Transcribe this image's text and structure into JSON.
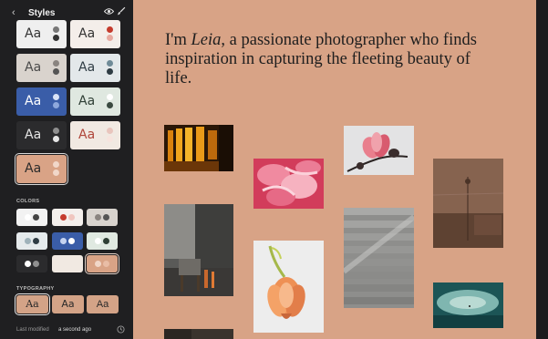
{
  "sidebar": {
    "back_glyph": "‹",
    "title": "Styles",
    "icons": [
      "eye-icon",
      "brush-icon"
    ],
    "theme_tiles": [
      {
        "label": "Aa",
        "bg": "#efefef",
        "fg": "#333333",
        "dot1": "#777777",
        "dot2": "#333333"
      },
      {
        "label": "Aa",
        "bg": "#f4eeea",
        "fg": "#333333",
        "dot1": "#c53b2d",
        "dot2": "#e8a9a0"
      },
      {
        "label": "Aa",
        "bg": "#d9d3cd",
        "fg": "#4a4a4a",
        "dot1": "#8a8480",
        "dot2": "#555555"
      },
      {
        "label": "Aa",
        "bg": "#e3e8ea",
        "fg": "#2f3c44",
        "dot1": "#6f8b98",
        "dot2": "#2f3c44"
      },
      {
        "label": "Aa",
        "bg": "#3a5da8",
        "fg": "#ffffff",
        "dot1": "#dbe4f7",
        "dot2": "#8ea8dc"
      },
      {
        "label": "Aa",
        "bg": "#dfe8e0",
        "fg": "#2f3f35",
        "dot1": "#ffffff",
        "dot2": "#3a4a40"
      },
      {
        "label": "Aa",
        "bg": "#2b2b2d",
        "fg": "#e6e6e6",
        "dot1": "#8f8f8f",
        "dot2": "#e6e6e6"
      },
      {
        "label": "Aa",
        "bg": "#f1e9e2",
        "fg": "#b0463a",
        "dot1": "#e9c5bd",
        "dot2": "#f7e4de"
      },
      {
        "label": "Aa",
        "bg": "#d9a386",
        "fg": "#2a2a2a",
        "dot1": "#f1d7c9",
        "dot2": "#f1d7c9"
      }
    ],
    "colors_heading": "COLORS",
    "color_swatches": [
      {
        "bg": "#f2f2f2",
        "c1": "#ffffff",
        "c2": "#444444"
      },
      {
        "bg": "#f4efec",
        "c1": "#c53b2d",
        "c2": "#f0c6bf"
      },
      {
        "bg": "#d8d3ce",
        "c1": "#8a8480",
        "c2": "#555555"
      },
      {
        "bg": "#e5eaec",
        "c1": "#9fb2ba",
        "c2": "#2f3c44"
      },
      {
        "bg": "#3a5da8",
        "c1": "#c5d3f0",
        "c2": "#ffffff"
      },
      {
        "bg": "#e0e9e1",
        "c1": "#ffffff",
        "c2": "#2f3f35"
      },
      {
        "bg": "#2b2b2d",
        "c1": "#ffffff",
        "c2": "#8f8f8f"
      },
      {
        "bg": "#f1e9e2",
        "c1": "#f1e9e2",
        "c2": "#f1e9e2"
      },
      {
        "bg": "#d9a386",
        "c1": "#f1d7c9",
        "c2": "#e9bda6"
      }
    ],
    "typography_heading": "TYPOGRAPHY",
    "typography_options": [
      "Aa",
      "Aa",
      "Aa"
    ],
    "last_modified_label": "Last modified",
    "last_modified_value": "a second ago",
    "clock_icon": "history-icon"
  },
  "canvas": {
    "bio_prefix": "I'm ",
    "bio_name": "Leia",
    "bio_rest": ", a passionate photographer who finds inspiration in capturing the fleeting beauty of life.",
    "background": "#d8a386",
    "photos": [
      "amber-corridor",
      "pink-petals",
      "magnolia-branch",
      "brick-interior",
      "chair-window",
      "tulip",
      "concrete-steps",
      "teal-seascape",
      "dark-strip"
    ]
  }
}
